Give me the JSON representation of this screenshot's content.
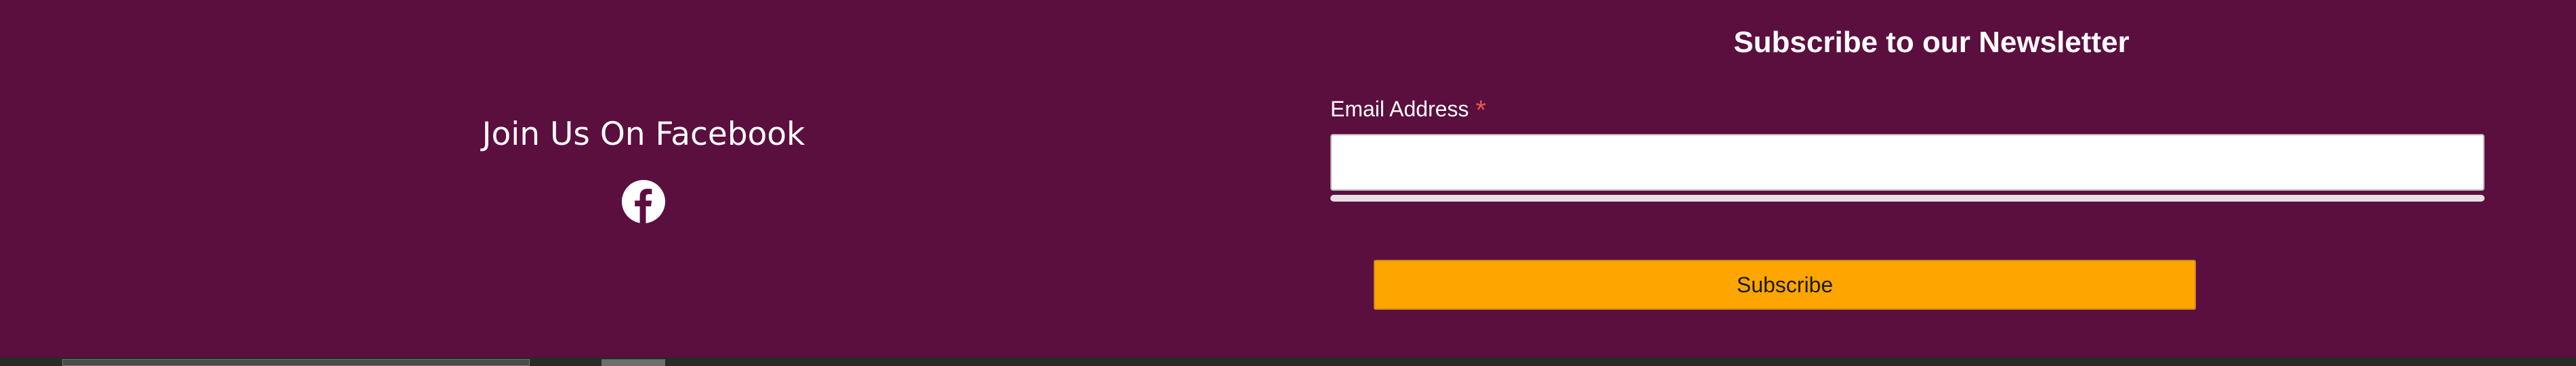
{
  "facebook": {
    "heading": "Join Us On Facebook",
    "icon": "facebook-icon"
  },
  "newsletter": {
    "title": "Subscribe to our Newsletter",
    "email_label": "Email Address",
    "required_mark": "*",
    "email_value": "",
    "email_placeholder": "",
    "subscribe_label": "Subscribe"
  },
  "colors": {
    "background": "#5b0f3f",
    "button": "#ffa500",
    "required": "#e65a4c"
  }
}
